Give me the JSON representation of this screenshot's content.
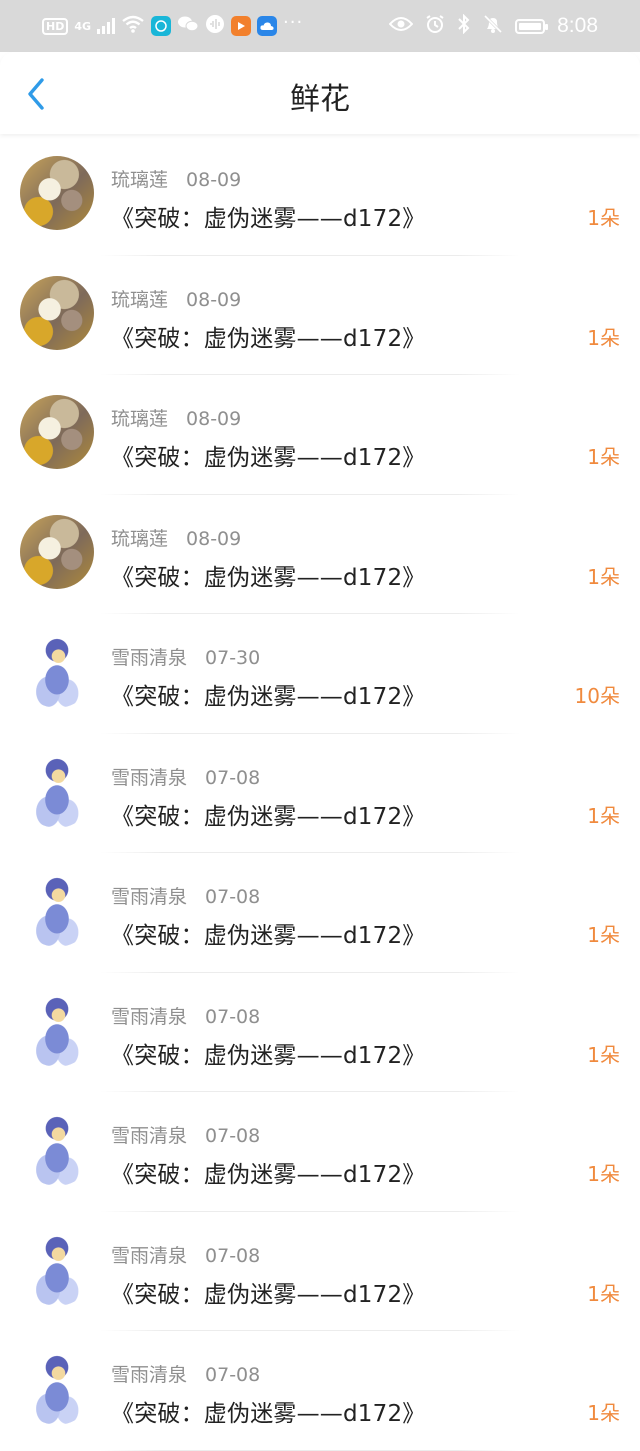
{
  "status_bar": {
    "hd_badge": "HD",
    "signal_label": "4G",
    "time": "8:08"
  },
  "nav": {
    "title": "鲜花"
  },
  "colors": {
    "accent_orange": "#f08a3e",
    "back_blue": "#2f9be8",
    "status_bar_bg": "#d9d9d9"
  },
  "records": [
    {
      "user": "琉璃莲",
      "date": "08-09",
      "book": "《突破：虚伪迷雾——d172》",
      "count": "1朵",
      "avatar": "avatar-a"
    },
    {
      "user": "琉璃莲",
      "date": "08-09",
      "book": "《突破：虚伪迷雾——d172》",
      "count": "1朵",
      "avatar": "avatar-a"
    },
    {
      "user": "琉璃莲",
      "date": "08-09",
      "book": "《突破：虚伪迷雾——d172》",
      "count": "1朵",
      "avatar": "avatar-a"
    },
    {
      "user": "琉璃莲",
      "date": "08-09",
      "book": "《突破：虚伪迷雾——d172》",
      "count": "1朵",
      "avatar": "avatar-a"
    },
    {
      "user": "雪雨清泉",
      "date": "07-30",
      "book": "《突破：虚伪迷雾——d172》",
      "count": "10朵",
      "avatar": "avatar-b"
    },
    {
      "user": "雪雨清泉",
      "date": "07-08",
      "book": "《突破：虚伪迷雾——d172》",
      "count": "1朵",
      "avatar": "avatar-b"
    },
    {
      "user": "雪雨清泉",
      "date": "07-08",
      "book": "《突破：虚伪迷雾——d172》",
      "count": "1朵",
      "avatar": "avatar-b"
    },
    {
      "user": "雪雨清泉",
      "date": "07-08",
      "book": "《突破：虚伪迷雾——d172》",
      "count": "1朵",
      "avatar": "avatar-b"
    },
    {
      "user": "雪雨清泉",
      "date": "07-08",
      "book": "《突破：虚伪迷雾——d172》",
      "count": "1朵",
      "avatar": "avatar-b"
    },
    {
      "user": "雪雨清泉",
      "date": "07-08",
      "book": "《突破：虚伪迷雾——d172》",
      "count": "1朵",
      "avatar": "avatar-b"
    },
    {
      "user": "雪雨清泉",
      "date": "07-08",
      "book": "《突破：虚伪迷雾——d172》",
      "count": "1朵",
      "avatar": "avatar-b"
    }
  ]
}
